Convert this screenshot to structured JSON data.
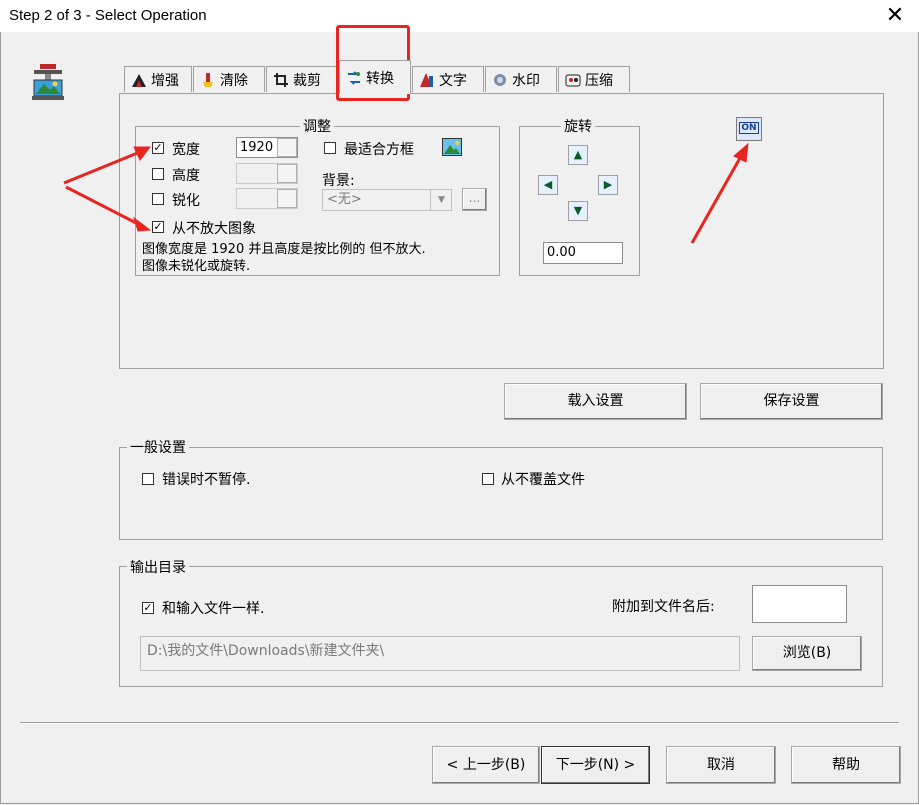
{
  "window": {
    "title": "Step 2 of 3 - Select Operation",
    "close_glyph": "✕"
  },
  "tabs": [
    {
      "label": "增强",
      "icon": "enhance-icon"
    },
    {
      "label": "清除",
      "icon": "clear-icon"
    },
    {
      "label": "裁剪",
      "icon": "crop-icon"
    },
    {
      "label": "转换",
      "icon": "convert-icon",
      "active": true
    },
    {
      "label": "文字",
      "icon": "text-icon"
    },
    {
      "label": "水印",
      "icon": "watermark-icon"
    },
    {
      "label": "压缩",
      "icon": "compress-icon"
    }
  ],
  "adjust": {
    "title": "调整",
    "width": {
      "label": "宽度",
      "checked": true,
      "value": "1920"
    },
    "height": {
      "label": "高度",
      "checked": false,
      "value": ""
    },
    "sharpen": {
      "label": "锐化",
      "checked": false,
      "value": ""
    },
    "best_fit": {
      "label": "最适合方框",
      "checked": false
    },
    "background": {
      "label": "背景:",
      "value": "<无>",
      "browse": "..."
    },
    "no_enlarge": {
      "label": "从不放大图象",
      "checked": true
    },
    "desc_line1": "图像宽度是 1920 并且高度是按比例的 但不放大.",
    "desc_line2": "图像未锐化或旋转."
  },
  "rotate": {
    "title": "旋转",
    "value": "0.00"
  },
  "on_button": "ON",
  "buttons": {
    "load": "载入设置",
    "save": "保存设置"
  },
  "general": {
    "title": "一般设置",
    "no_pause": {
      "label": "错误时不暂停.",
      "checked": false
    },
    "no_overwrite": {
      "label": "从不覆盖文件",
      "checked": false
    }
  },
  "output": {
    "title": "输出目录",
    "same_as_input": {
      "label": "和输入文件一样.",
      "checked": true
    },
    "append_label": "附加到文件名后:",
    "append_value": "",
    "path": "D:\\我的文件\\Downloads\\新建文件夹\\",
    "browse": "浏览(B)"
  },
  "footer": {
    "back": "< 上一步(B)",
    "next": "下一步(N) >",
    "cancel": "取消",
    "help": "帮助"
  },
  "colors": {
    "annotation": "#e8251f",
    "window_bg": "#f0f0f0"
  }
}
